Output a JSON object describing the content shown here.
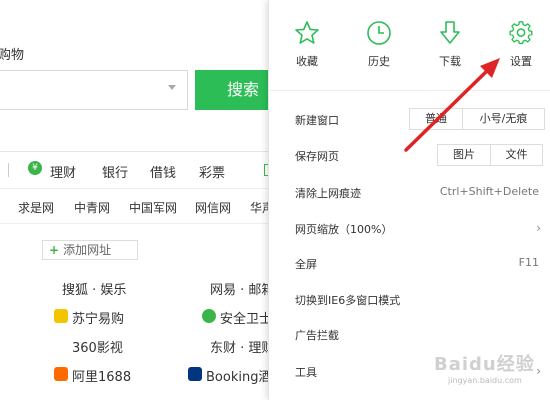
{
  "background": {
    "title_fragment": "购物",
    "search_button": "搜索",
    "nav_items": [
      "理财",
      "银行",
      "借钱",
      "彩票"
    ],
    "links": [
      "求是网",
      "中青网",
      "中国军网",
      "网信网",
      "华声"
    ],
    "add_site": "添加网址",
    "sites": [
      {
        "label": "搜狐 · 娱乐"
      },
      {
        "label": "网易 · 邮箱"
      },
      {
        "label": "苏宁易购",
        "icon_color": "#f5c400"
      },
      {
        "label": "安全卫士",
        "icon_color": "#3bb54a"
      },
      {
        "label": "360影视"
      },
      {
        "label": "东财 · 理财"
      },
      {
        "label": "阿里1688",
        "icon_color": "#ff6a00"
      },
      {
        "label": "Booking酒店",
        "icon_color": "#003580"
      }
    ]
  },
  "menu": {
    "top_icons": [
      {
        "label": "收藏",
        "icon": "star-icon"
      },
      {
        "label": "历史",
        "icon": "clock-icon"
      },
      {
        "label": "下载",
        "icon": "download-icon"
      },
      {
        "label": "设置",
        "icon": "gear-icon"
      }
    ],
    "new_window": {
      "label": "新建窗口",
      "options": [
        "普通",
        "小号/无痕"
      ]
    },
    "save_page": {
      "label": "保存网页",
      "options": [
        "图片",
        "文件"
      ]
    },
    "clear_traces": {
      "label": "清除上网痕迹",
      "shortcut": "Ctrl+Shift+Delete"
    },
    "zoom": {
      "label": "网页缩放（100%）"
    },
    "fullscreen": {
      "label": "全屏",
      "shortcut": "F11"
    },
    "ie6_mode": {
      "label": "切换到IE6多窗口模式"
    },
    "ad_block": {
      "label": "广告拦截"
    },
    "tools": {
      "label": "工具"
    }
  },
  "colors": {
    "accent_green": "#2cbd57",
    "arrow_red": "#e02424"
  },
  "watermark": {
    "text": "Baidu经验",
    "url": "jingyan.baidu.com"
  }
}
